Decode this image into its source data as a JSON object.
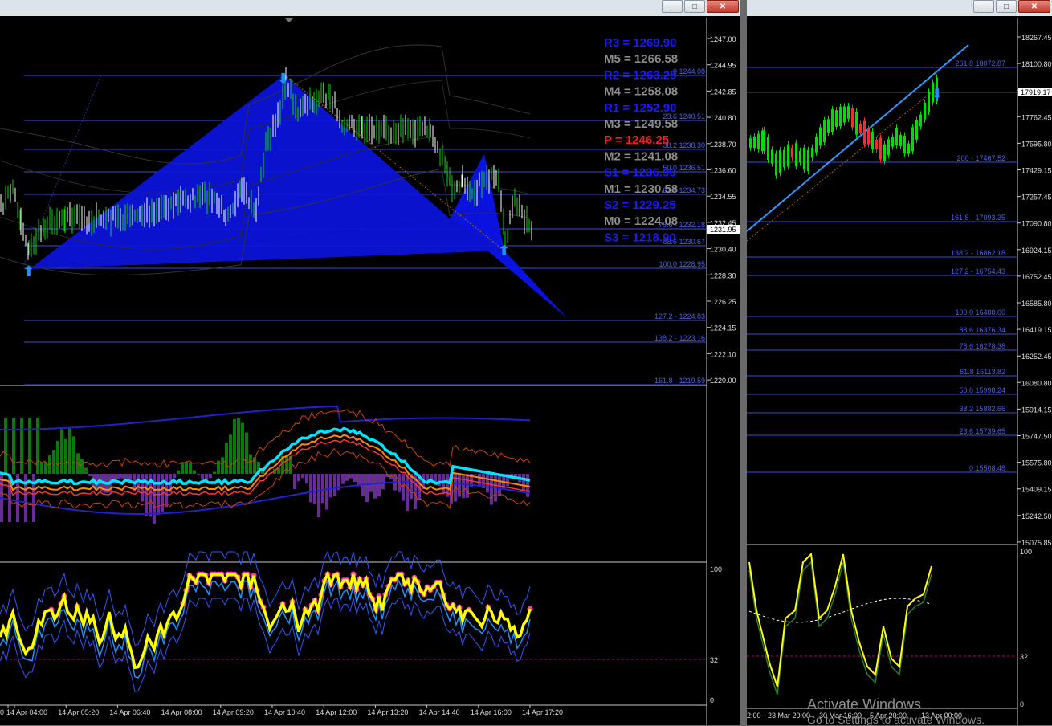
{
  "left_chart": {
    "price_axis": [
      "1247.00",
      "1244.95",
      "1242.85",
      "1240.80",
      "1238.70",
      "1236.60",
      "1234.55",
      "1232.45",
      "1230.40",
      "1228.30",
      "1226.25",
      "1224.15",
      "1222.10",
      "1220.00"
    ],
    "current_price": "1231.95",
    "pivots": [
      {
        "label": "R3 = 1269.90",
        "color": "#1a1aff"
      },
      {
        "label": "M5 = 1266.58",
        "color": "#8c8c8c"
      },
      {
        "label": "R2 = 1263.25",
        "color": "#1a1aff"
      },
      {
        "label": "M4 = 1258.08",
        "color": "#8c8c8c"
      },
      {
        "label": "R1 = 1252.90",
        "color": "#1a1aff"
      },
      {
        "label": "M3 = 1249.58",
        "color": "#8c8c8c"
      },
      {
        "label": "P   = 1246.25",
        "color": "#ff1a1a"
      },
      {
        "label": "M2 = 1241.08",
        "color": "#8c8c8c"
      },
      {
        "label": "S1 = 1236.90",
        "color": "#1a1aff"
      },
      {
        "label": "M1 = 1230.58",
        "color": "#8c8c8c"
      },
      {
        "label": "S2 = 1229.25",
        "color": "#1a1aff"
      },
      {
        "label": "M0 = 1224.08",
        "color": "#8c8c8c"
      },
      {
        "label": "S3 = 1218.90",
        "color": "#1a1aff"
      }
    ],
    "fib_levels": [
      "0 1244.08",
      "23.6 1240.51",
      "38.2 1238.30",
      "50.0 1236.51",
      "61.8 1234.73",
      "78.6 - 1232.18",
      "88.6 1230.67",
      "100.0 1228.95",
      "127.2 - 1224.83",
      "138.2 - 1223.16",
      "161.8 - 1219.59"
    ],
    "time_axis": [
      "0",
      "14 Apr 04:00",
      "14 Apr 05:20",
      "14 Apr 06:40",
      "14 Apr 08:00",
      "14 Apr 09:20",
      "14 Apr 10:40",
      "14 Apr 12:00",
      "14 Apr 13:20",
      "14 Apr 14:40",
      "14 Apr 16:00",
      "14 Apr 17:20"
    ],
    "osc_axis": [
      "100",
      "32",
      "0"
    ]
  },
  "right_chart": {
    "price_axis": [
      "18267.45",
      "18100.80",
      "17919.17",
      "17762.45",
      "17595.80",
      "17429.15",
      "17257.45",
      "17090.80",
      "16924.15",
      "16752.45",
      "16585.80",
      "16419.15",
      "16252.45",
      "16080.80",
      "15914.15",
      "15747.50",
      "15575.80",
      "15409.15",
      "15242.50",
      "15075.85"
    ],
    "current_price": "17919.17",
    "fib_levels": [
      "261.8 18072.87",
      "200 - 17467.52",
      "161.8 - 17093.35",
      "138.2 - 16862.18",
      "127.2 - 16754.43",
      "100.0 16488.00",
      "88.6 16376.34",
      "78.6 16278.38",
      "61.8 16113.82",
      "50.0 15998.24",
      "38.2 15882.66",
      "23.6 15739.65",
      "0 15508.48"
    ],
    "time_axis": [
      "2:00",
      "23 Mar 20:00",
      "30 Mar 16:00",
      "5 Apr 20:00",
      "13 Apr 00:00"
    ],
    "osc_axis": [
      "100",
      "32",
      "0"
    ]
  },
  "window_buttons": {
    "minimize": "_",
    "maximize": "□",
    "close": "✕"
  },
  "watermark": {
    "line1": "Activate Windows",
    "line2": "Go to Settings to activate Windows."
  },
  "colors": {
    "harmonic": "#0b14e0",
    "fib": "#3a4fd8",
    "candle_up": "#00dd00",
    "candle_down": "#ff2a2a",
    "rsi": "#ffff00",
    "rsi_dots": "#ff33aa",
    "osc_line": "#00e5ff",
    "hist_up": "#0a7a0a",
    "hist_down": "#6a2a9a"
  }
}
